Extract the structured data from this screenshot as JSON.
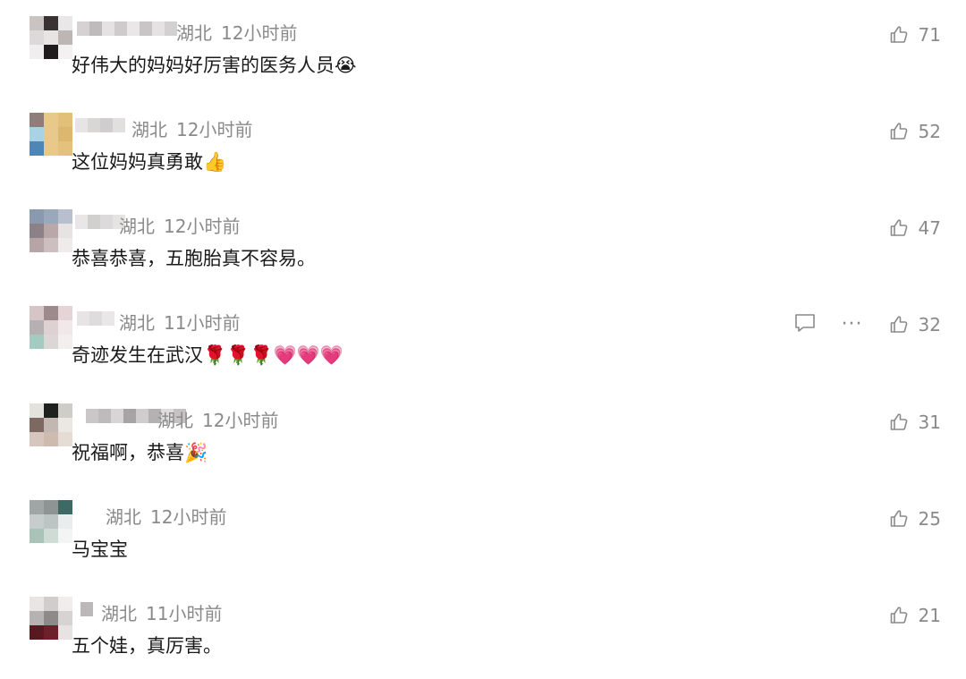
{
  "comments": [
    {
      "region": "湖北",
      "time": "12小时前",
      "text": "好伟大的妈妈好厉害的医务人员",
      "emojis": [
        "😭"
      ],
      "likes": "71",
      "icons": [
        "like-icon"
      ],
      "avatar_colors": [
        "#c9c3c1",
        "#3b3234",
        "#e9e7e8",
        "#ddd8d9",
        "#e8e4e4",
        "#bdb6b4",
        "#f0eeee",
        "#1f1b1c",
        "#f3f1f1"
      ],
      "name_colors": [
        "#d6d2d3",
        "#bfbbbc",
        "#e5e2e3",
        "#cfcbcc",
        "#e9e7e8",
        "#c9c5c6",
        "#e4e2e2",
        "#d3d0d0"
      ]
    },
    {
      "region": "湖北",
      "time": "12小时前",
      "text": "这位妈妈真勇敢",
      "emojis": [
        "👍"
      ],
      "likes": "52",
      "icons": [
        "like-icon"
      ],
      "avatar_colors": [
        "#8f7d7a",
        "#e9c98a",
        "#e3c07a",
        "#a9d3e4",
        "#e7c88d",
        "#dcb86f",
        "#4f86b8",
        "#e9c98a",
        "#e4c27e"
      ],
      "name_colors": [
        "#e6e4e4",
        "#d9d6d6",
        "#cfcdcd",
        "#e2dfdf"
      ]
    },
    {
      "region": "湖北",
      "time": "12小时前",
      "text": "恭喜恭喜，五胞胎真不容易。",
      "emojis": [],
      "likes": "47",
      "icons": [
        "like-icon"
      ],
      "avatar_colors": [
        "#8a99ae",
        "#9aa8bb",
        "#b7c0cc",
        "#8c8187",
        "#b9a8a7",
        "#e7e2e3",
        "#b7a4a6",
        "#cdbfc0",
        "#efebeb"
      ],
      "name_colors": [
        "#e8e6e6",
        "#d2cfcf",
        "#dcdada",
        "#e6e3e3"
      ]
    },
    {
      "region": "湖北",
      "time": "11小时前",
      "text": "奇迹发生在武汉",
      "emojis": [
        "🌹",
        "🌹",
        "🌹",
        "💗",
        "💗",
        "💗"
      ],
      "likes": "32",
      "icons": [
        "reply-icon",
        "more-icon",
        "like-icon"
      ],
      "avatar_colors": [
        "#d6c5c6",
        "#9d8a8c",
        "#e4d4d5",
        "#b7b0b2",
        "#ddd1d2",
        "#f0e8e9",
        "#a4cbc0",
        "#ddd6d7",
        "#f3efef"
      ],
      "name_colors": [
        "#e6e4e4",
        "#dedcdc",
        "#e9e7e7"
      ]
    },
    {
      "region": "湖北",
      "time": "12小时前",
      "text": "祝福啊，恭喜",
      "emojis": [
        "🎉"
      ],
      "likes": "31",
      "icons": [
        "like-icon"
      ],
      "avatar_colors": [
        "#e4e2dc",
        "#1e211d",
        "#cfcdc7",
        "#7d6961",
        "#c2b8b1",
        "#ebe7e3",
        "#d6c6bd",
        "#cdbbb0",
        "#e6dcd6"
      ],
      "name_colors": [
        "#c9c7c8",
        "#bdbbbc",
        "#d7d5d6",
        "#a6a4a5",
        "#cfcdce",
        "#b3b1b2",
        "#dedcdd",
        "#c4c2c3"
      ]
    },
    {
      "region": "湖北",
      "time": "12小时前",
      "text": "马宝宝",
      "emojis": [],
      "likes": "25",
      "icons": [
        "like-icon"
      ],
      "avatar_colors": [
        "#9fa6a5",
        "#8d9493",
        "#3d6a64",
        "#c7cdcc",
        "#bcc5c3",
        "#eaeded",
        "#a9c4b7",
        "#cfdcd6",
        "#f3f5f5"
      ],
      "name_colors": []
    },
    {
      "region": "湖北",
      "time": "11小时前",
      "text": "五个娃，真厉害。",
      "emojis": [],
      "likes": "21",
      "icons": [
        "like-icon"
      ],
      "avatar_colors": [
        "#e9e5e5",
        "#d2cdcd",
        "#f0eded",
        "#b7b2b2",
        "#8f8a8a",
        "#d7d3d3",
        "#5a1820",
        "#6d1f2a",
        "#e8e2e3"
      ],
      "name_colors": [
        "#bcb8b9"
      ]
    }
  ]
}
